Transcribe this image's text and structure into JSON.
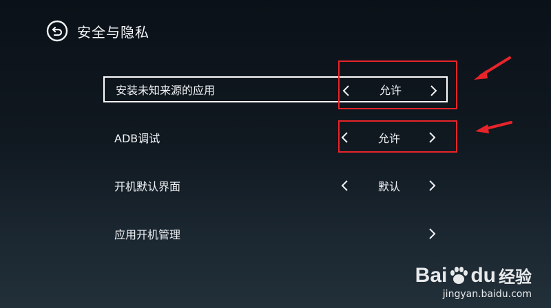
{
  "header": {
    "title": "安全与隐私",
    "back_icon": "back-icon"
  },
  "settings": [
    {
      "label": "安装未知来源的应用",
      "value": "允许",
      "has_left": true,
      "has_right": true,
      "focused": true
    },
    {
      "label": "ADB调试",
      "value": "允许",
      "has_left": true,
      "has_right": true,
      "focused": false
    },
    {
      "label": "开机默认界面",
      "value": "默认",
      "has_left": true,
      "has_right": true,
      "focused": false
    },
    {
      "label": "应用开机管理",
      "value": "",
      "has_left": false,
      "has_right": true,
      "focused": false
    }
  ],
  "annotation_color": "#e8242a",
  "watermark": {
    "brand": "Bai du 经验",
    "brand_left": "Bai",
    "brand_right": "du",
    "brand_cn": "经验",
    "url": "jingyan.baidu.com"
  }
}
